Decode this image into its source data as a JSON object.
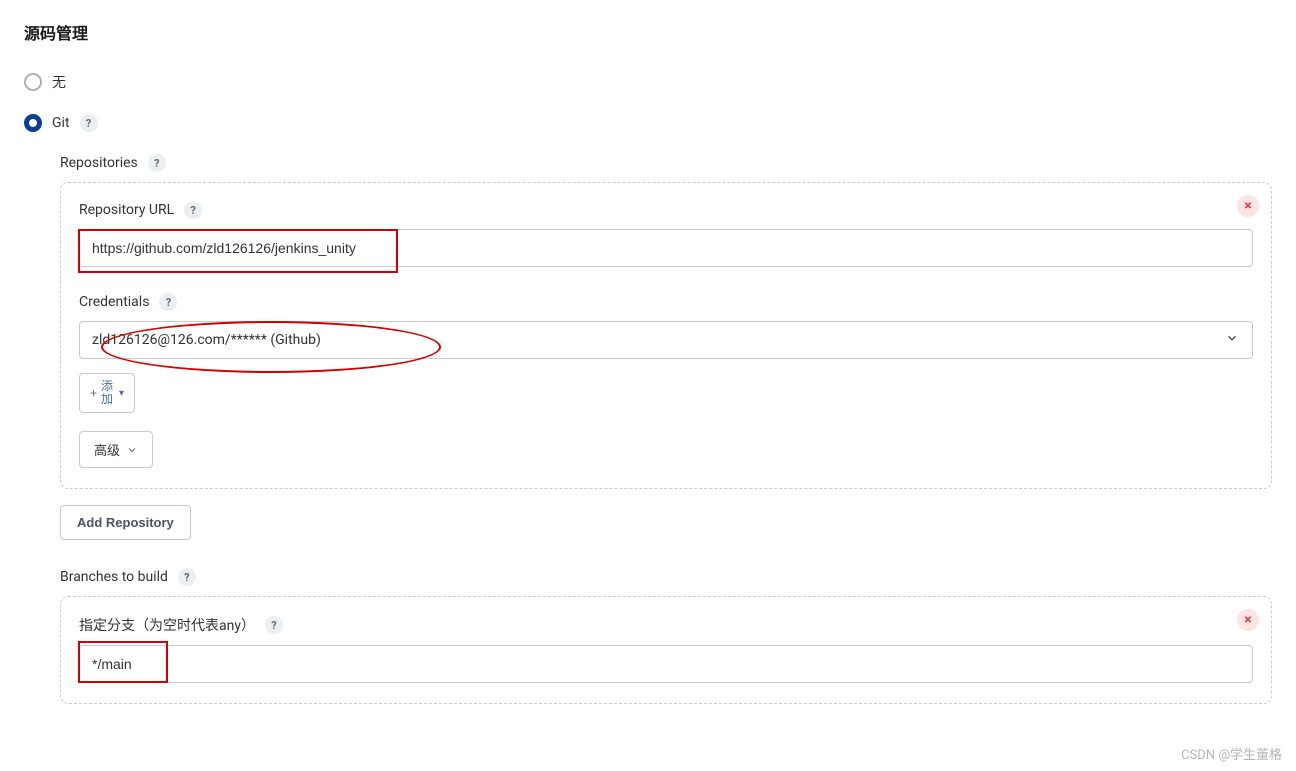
{
  "section": {
    "title": "源码管理"
  },
  "radios": {
    "none": "无",
    "git": "Git"
  },
  "repositories": {
    "label": "Repositories",
    "url_label": "Repository URL",
    "url_value": "https://github.com/zld126126/jenkins_unity",
    "credentials_label": "Credentials",
    "credentials_value": "zld126126@126.com/****** (Github)",
    "add_label": "添\n加",
    "advanced_label": "高级",
    "add_repo_label": "Add Repository"
  },
  "branches": {
    "label": "Branches to build",
    "spec_label": "指定分支（为空时代表any）",
    "spec_value": "*/main"
  },
  "watermark": "CSDN @学生董格"
}
